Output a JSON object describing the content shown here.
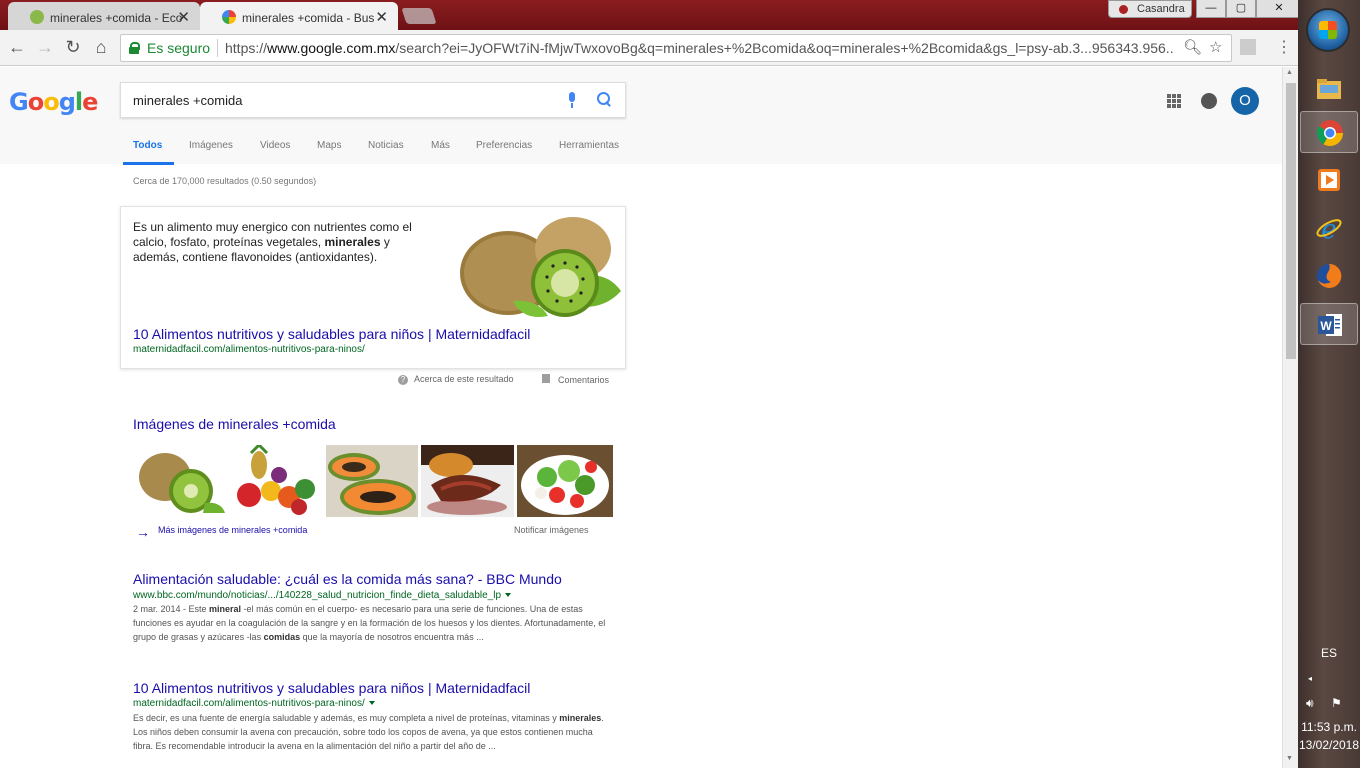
{
  "browser": {
    "tabs": [
      {
        "label": "minerales +comida - Eco",
        "close": "✕"
      },
      {
        "label": "minerales +comida - Bus",
        "close": "✕"
      }
    ],
    "ghost_title": "",
    "user_label": "Casandra",
    "window_buttons": {
      "min": "—",
      "max": "▢",
      "close": "✕"
    },
    "secure_label": "Es seguro",
    "url_prefix": "https://",
    "url_host": "www.google.com.mx",
    "url_rest": "/search?ei=JyOFWt7iN-fMjwTwxovoBg&q=minerales+%2Bcomida&oq=minerales+%2Bcomida&gs_l=psy-ab.3...956343.956..."
  },
  "google": {
    "logo_letters": [
      "G",
      "o",
      "o",
      "g",
      "l",
      "e"
    ],
    "logo_colors": [
      "#4285f4",
      "#ea4335",
      "#fbbc05",
      "#4285f4",
      "#34a853",
      "#ea4335"
    ],
    "query": "minerales +comida",
    "avatar_letter": "O",
    "tabs": [
      "Todos",
      "Imágenes",
      "Videos",
      "Maps",
      "Noticias",
      "Más",
      "Preferencias",
      "Herramientas"
    ],
    "stats": "Cerca de 170,000 resultados (0.50 segundos)"
  },
  "snippet": {
    "desc_1": "Es un alimento muy energico con nutrientes como el calcio, fosfato, proteínas vegetales, ",
    "desc_bold": "minerales",
    "desc_2": " y además, contiene flavonoides (antioxidantes).",
    "title": "10 Alimentos nutritivos y saludables para niños | Maternidadfacil",
    "url": "maternidadfacil.com/alimentos-nutritivos-para-ninos/",
    "about": "Acerca de este resultado",
    "feedback": "Comentarios"
  },
  "images": {
    "title": "Imágenes de minerales +comida",
    "more": "Más imágenes de minerales +comida",
    "report": "Notificar imágenes"
  },
  "results": [
    {
      "title": "Alimentación saludable: ¿cuál es la comida más sana? - BBC Mundo",
      "url": "www.bbc.com/mundo/noticias/.../140228_salud_nutricion_finde_dieta_saludable_lp",
      "date": "2 mar. 2014 - ",
      "s1": "Este ",
      "b1": "mineral",
      "s2": " -el más común en el cuerpo- es necesario para una serie de funciones. Una de estas funciones es ayudar en la coagulación de la sangre y en la formación de los huesos y los dientes. Afortunadamente, el grupo de grasas y azúcares -las ",
      "b2": "comidas",
      "s3": " que la mayoría de nosotros encuentra más ..."
    },
    {
      "title": "10 Alimentos nutritivos y saludables para niños | Maternidadfacil",
      "url": "maternidadfacil.com/alimentos-nutritivos-para-ninos/",
      "date": "",
      "s1": "Es decir, es una fuente de energía saludable y además, es muy completa a nivel de proteínas, vitaminas y ",
      "b1": "minerales",
      "s2": ". Los niños deben consumir la avena con precaución, sobre todo los copos de avena, ya que estos contienen mucha fibra. Es recomendable introducir la avena en la alimentación del niño a partir del año de ...",
      "b2": "",
      "s3": ""
    }
  ],
  "taskbar": {
    "lang": "ES",
    "time": "11:53 p.m.",
    "date": "13/02/2018"
  }
}
